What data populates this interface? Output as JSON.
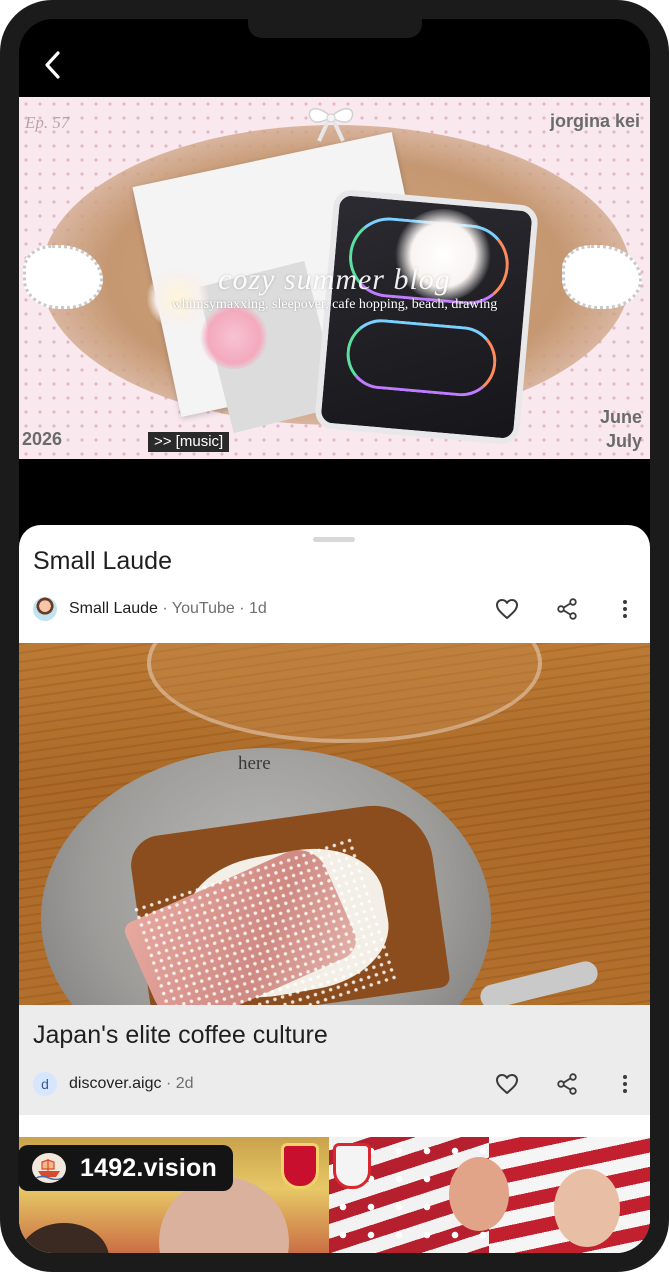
{
  "video": {
    "episode": "Ep. 57",
    "channel_tag": "jorgina kei",
    "title_overlay": "cozy summer blog",
    "subtitle_overlay": "whimsymaxxing, sleepover, cafe hopping, beach, drawing",
    "year": "2026",
    "months_top": "June",
    "months_bottom": "July",
    "caption": ">> [music]"
  },
  "result1": {
    "title": "Small Laude",
    "source": "Small Laude",
    "meta": " · YouTube · 1d"
  },
  "result2": {
    "plate_text": "here",
    "title": "Japan's elite coffee culture",
    "avatar_letter": "d",
    "source": "discover.aigc",
    "meta": " · 2d"
  },
  "badge": {
    "text": "1492.vision"
  },
  "colors": {
    "sheet_bg": "#ffffff",
    "card_foot_bg": "#ececec",
    "badge_bg": "#141414",
    "text_primary": "#1f1f1f",
    "text_secondary": "#6f6f6f"
  },
  "icons": [
    "back-arrow-icon",
    "heart-icon",
    "share-icon",
    "more-vert-icon",
    "ship-logo-icon"
  ]
}
